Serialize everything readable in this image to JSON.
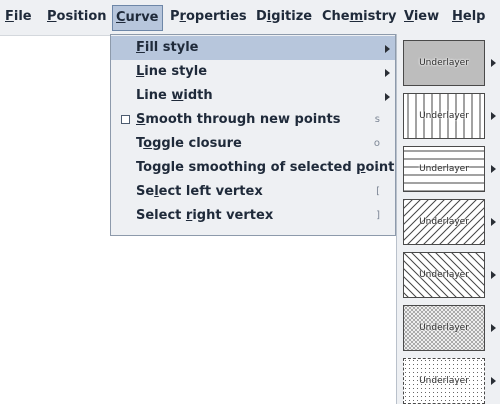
{
  "menubar": {
    "items": [
      {
        "pre": "",
        "mn": "F",
        "post": "ile"
      },
      {
        "pre": "",
        "mn": "P",
        "post": "osition"
      },
      {
        "pre": "",
        "mn": "C",
        "post": "urve"
      },
      {
        "pre": "P",
        "mn": "r",
        "post": "operties"
      },
      {
        "pre": "D",
        "mn": "i",
        "post": "gitize"
      },
      {
        "pre": "Che",
        "mn": "m",
        "post": "istry"
      },
      {
        "pre": "",
        "mn": "V",
        "post": "iew"
      },
      {
        "pre": "",
        "mn": "H",
        "post": "elp"
      }
    ]
  },
  "curve_menu": {
    "items": [
      {
        "pre": "",
        "mn": "F",
        "post": "ill style",
        "shortcut": ""
      },
      {
        "pre": "",
        "mn": "L",
        "post": "ine style",
        "shortcut": ""
      },
      {
        "pre": "Line ",
        "mn": "w",
        "post": "idth",
        "shortcut": ""
      },
      {
        "pre": "",
        "mn": "S",
        "post": "mooth through new points",
        "shortcut": "s"
      },
      {
        "pre": "T",
        "mn": "o",
        "post": "ggle closure",
        "shortcut": "o"
      },
      {
        "pre": "Toggle smoothing of selected ",
        "mn": "p",
        "post": "oint",
        "shortcut": "."
      },
      {
        "pre": "Se",
        "mn": "l",
        "post": "ect left vertex",
        "shortcut": "["
      },
      {
        "pre": "Select ",
        "mn": "r",
        "post": "ight vertex",
        "shortcut": "]"
      }
    ]
  },
  "fill_submenu": {
    "items": [
      {
        "label": "Underlayer",
        "pattern": "solid"
      },
      {
        "label": "Underlayer",
        "pattern": "vertical-lines"
      },
      {
        "label": "Underlayer",
        "pattern": "horizontal-lines"
      },
      {
        "label": "Underlayer",
        "pattern": "diagonal-up"
      },
      {
        "label": "Underlayer",
        "pattern": "diagonal-down"
      },
      {
        "label": "Underlayer",
        "pattern": "crosshatch"
      },
      {
        "label": "Underlayer",
        "pattern": "dots"
      }
    ]
  },
  "colors": {
    "menubar_bg": "#eef0f3",
    "highlight": "#b7c6dc",
    "text": "#1f2a3a",
    "solid_swatch": "#bdbdbd"
  }
}
